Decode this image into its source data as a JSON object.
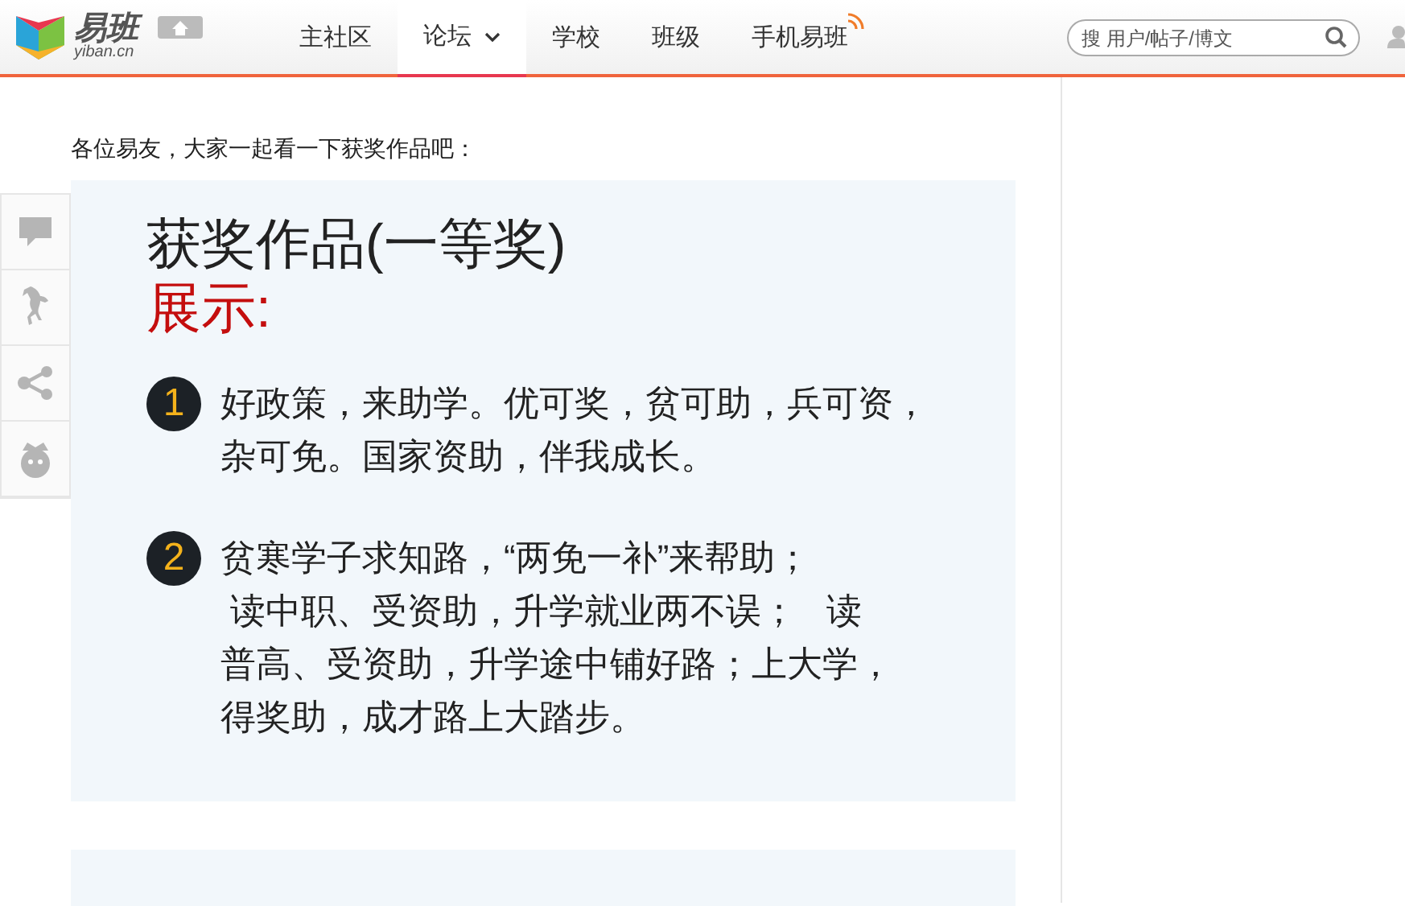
{
  "header": {
    "logo_text": "易班",
    "logo_domain": "yiban.cn",
    "nav": [
      {
        "label": "主社区",
        "selected": false,
        "dropdown": false,
        "badge": false
      },
      {
        "label": "论坛",
        "selected": true,
        "dropdown": true,
        "badge": false
      },
      {
        "label": "学校",
        "selected": false,
        "dropdown": false,
        "badge": false
      },
      {
        "label": "班级",
        "selected": false,
        "dropdown": false,
        "badge": false
      },
      {
        "label": "手机易班",
        "selected": false,
        "dropdown": false,
        "badge": true
      }
    ],
    "search": {
      "placeholder": "搜 用户/帖子/博文"
    }
  },
  "post": {
    "intro": "各位易友，大家一起看一下获奖作品吧：",
    "card": {
      "title": "获奖作品(一等奖)",
      "subtitle": "展示:",
      "items": [
        {
          "number": "1",
          "lines": [
            "好政策，来助学。优可奖，贫可助，兵可资，",
            "杂可免。国家资助，伴我成长。"
          ]
        },
        {
          "number": "2",
          "lines": [
            "贫寒学子求知路，“两免一补”来帮助；",
            " 读中职、受资助，升学就业两不误；   读",
            "普高、受资助，升学途中铺好路；上大学，",
            "得奖助，成才路上大踏步。"
          ]
        }
      ]
    }
  }
}
